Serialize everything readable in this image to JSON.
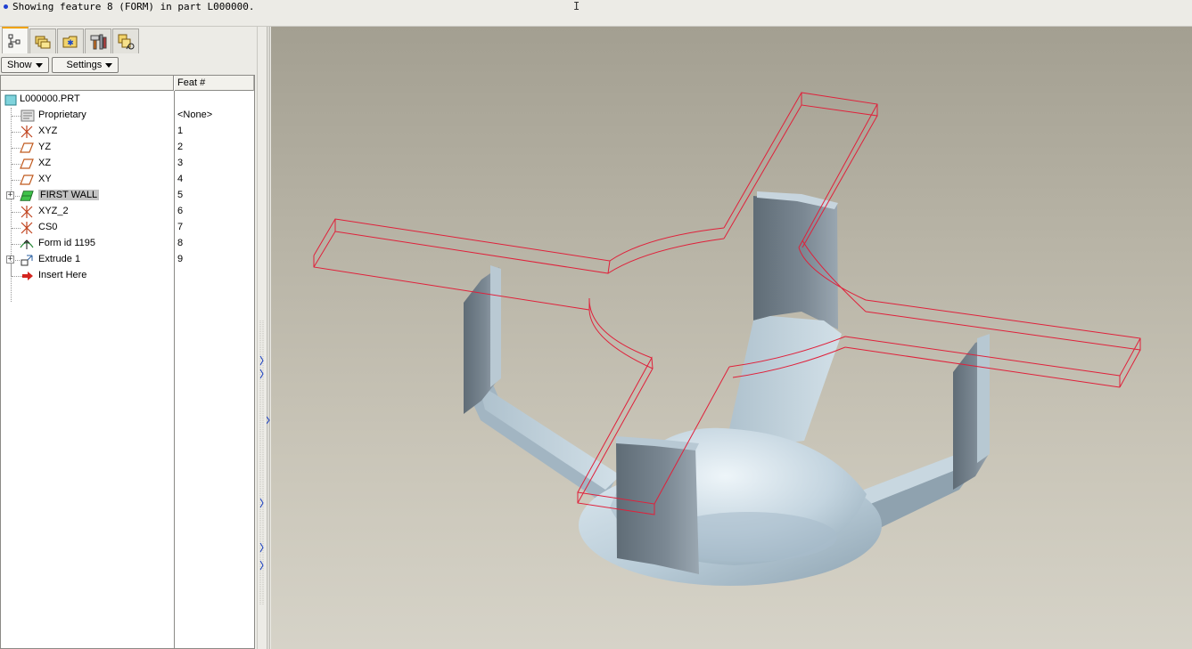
{
  "message_bar": {
    "text": "Showing feature 8 (FORM) in part L000000."
  },
  "navigator": {
    "tabs": [
      {
        "name": "model-tree-tab",
        "icon": "tree-icon",
        "active": true
      },
      {
        "name": "folder-browser-tab",
        "icon": "folders-icon",
        "active": false
      },
      {
        "name": "favorites-tab",
        "icon": "star-folder-icon",
        "active": false
      },
      {
        "name": "tools-tab",
        "icon": "tools-icon",
        "active": false
      },
      {
        "name": "connections-tab",
        "icon": "connections-icon",
        "active": false
      }
    ],
    "show_label": "Show",
    "settings_label": "Settings",
    "columns": {
      "name": "",
      "feat": "Feat #"
    },
    "tree": [
      {
        "label": "L000000.PRT",
        "feat": "",
        "icon": "part-icon"
      },
      {
        "label": "Proprietary",
        "feat": "<None>",
        "icon": "note-icon"
      },
      {
        "label": "XYZ",
        "feat": "1",
        "icon": "coordinate-system-icon"
      },
      {
        "label": "YZ",
        "feat": "2",
        "icon": "datum-plane-icon"
      },
      {
        "label": "XZ",
        "feat": "3",
        "icon": "datum-plane-icon"
      },
      {
        "label": "XY",
        "feat": "4",
        "icon": "datum-plane-icon"
      },
      {
        "label": "FIRST WALL",
        "feat": "5",
        "icon": "sheetmetal-wall-icon"
      },
      {
        "label": "XYZ_2",
        "feat": "6",
        "icon": "coordinate-system-icon"
      },
      {
        "label": "CS0",
        "feat": "7",
        "icon": "coordinate-system-icon"
      },
      {
        "label": "Form id 1195",
        "feat": "8",
        "icon": "form-feature-icon"
      },
      {
        "label": "Extrude 1",
        "feat": "9",
        "icon": "extrude-icon"
      },
      {
        "label": "Insert Here",
        "feat": "",
        "icon": "insert-arrow-icon"
      }
    ]
  },
  "colors": {
    "accent_tab": "#f0a200",
    "preview_outline": "#e0203a",
    "selection": "#c3c3c3"
  }
}
